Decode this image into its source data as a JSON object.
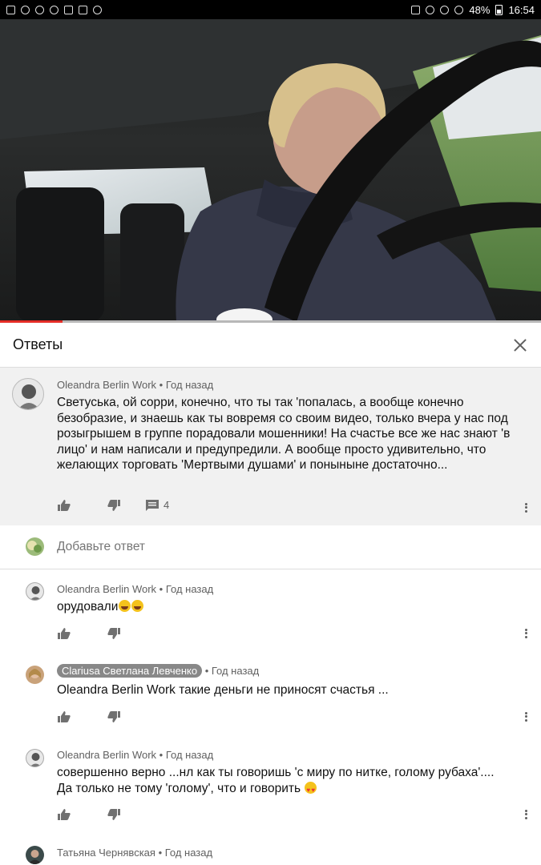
{
  "status_bar": {
    "battery": "48%",
    "time": "16:54"
  },
  "video": {
    "progress": 0.116
  },
  "replies": {
    "title": "Ответы"
  },
  "parent_comment": {
    "author": "Oleandra Berlin Work",
    "time": "• Год назад",
    "text": "Светуська, ой сорри, конечно, что ты так 'попалась, а вообще конечно безобразие, и знаешь как ты вовремя со своим видео, только вчера у нас под розыгрышем в группе порадовали мошенники! На счастье все же нас знают 'в лицо' и нам написали и предупредили. А вообще просто удивительно, что желающих торговать  'Мертвыми душами' и понынынe достаточно...",
    "reply_count": "4"
  },
  "add_reply": {
    "placeholder": "Добавьте ответ"
  },
  "comments": [
    {
      "author": "Oleandra Berlin Work",
      "time": "• Год назад",
      "text": "орудовали"
    },
    {
      "author": "Clariusa Светлана Левченко",
      "time": "• Год назад",
      "text": "Oleandra Berlin Work такие деньги не приносят счастья ..."
    },
    {
      "author": "Oleandra Berlin Work",
      "time": "• Год назад",
      "text_line1": "совершенно верно ...нл как ты говоришь 'с миру по нитке, голому рубаха'....",
      "text_line2": "Да только не тому 'голому', что и говорить"
    },
    {
      "author": "Татьяна Чернявская",
      "time": "• Год назад"
    }
  ]
}
